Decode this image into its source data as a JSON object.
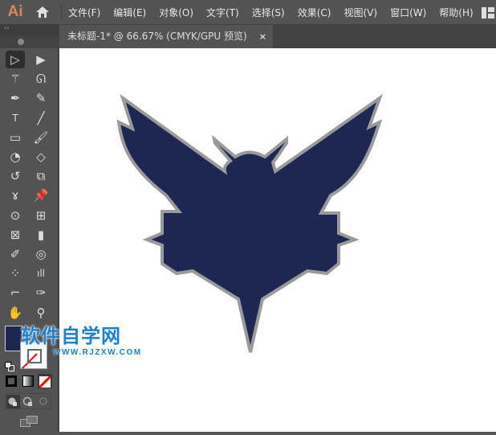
{
  "app": {
    "logo": "Ai"
  },
  "menu": [
    "文件(F)",
    "编辑(E)",
    "对象(O)",
    "文字(T)",
    "选择(S)",
    "效果(C)",
    "视图(V)",
    "窗口(W)",
    "帮助(H)"
  ],
  "tab": {
    "title": "未标题-1* @ 66.67% (CMYK/GPU 预览)",
    "close": "×"
  },
  "panel": {
    "collapse": "‹‹"
  },
  "tools": [
    "selection",
    "direct-selection",
    "magic-wand",
    "lasso",
    "pen",
    "curvature",
    "type",
    "line",
    "rectangle",
    "paintbrush",
    "shaper",
    "eraser",
    "rotate",
    "scale",
    "warp",
    "puppet-warp",
    "shape-builder",
    "perspective-grid",
    "mesh",
    "gradient",
    "eyedropper",
    "blend",
    "symbol-sprayer",
    "column-graph",
    "artboard",
    "slice",
    "hand",
    "zoom"
  ],
  "colors": {
    "fill": "#1e2752",
    "stroke": "#9a9a9c",
    "accent": "#d5895a"
  },
  "watermark": {
    "line1": "软件自学网",
    "line2": "WWW.RJZXW.COM"
  }
}
